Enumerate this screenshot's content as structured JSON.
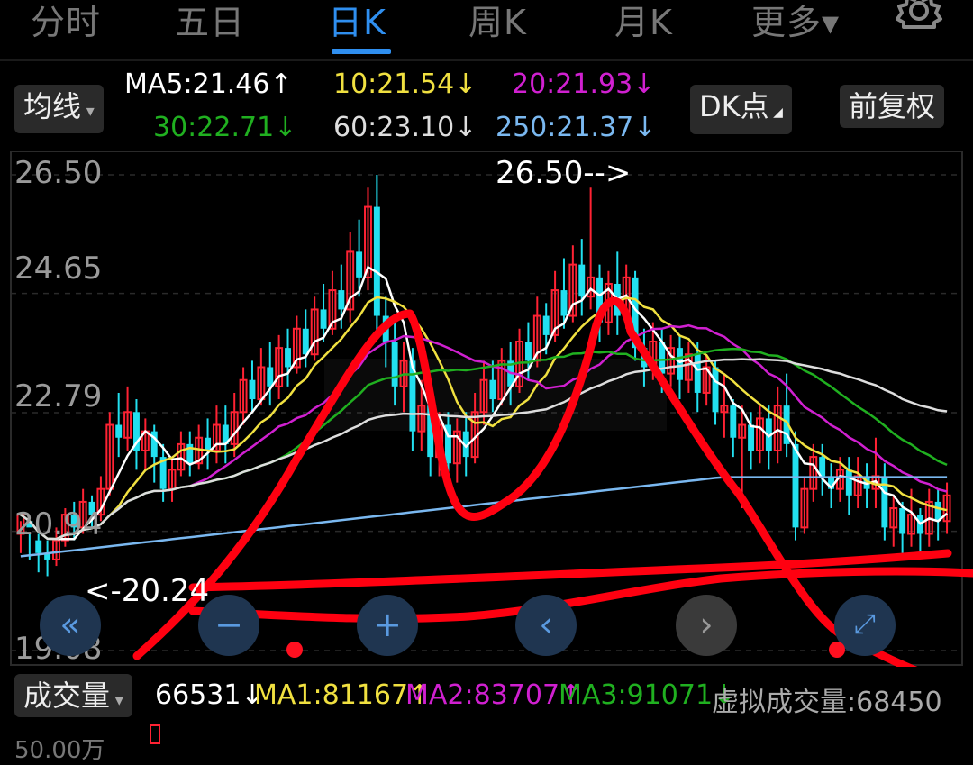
{
  "tabs": [
    {
      "label": "分时",
      "active": false
    },
    {
      "label": "五日",
      "active": false
    },
    {
      "label": "日K",
      "active": true
    },
    {
      "label": "周K",
      "active": false
    },
    {
      "label": "月K",
      "active": false
    },
    {
      "label": "更多▾",
      "active": false
    }
  ],
  "indicator_select": "均线",
  "ma_labels": {
    "ma5": "MA5:21.46↑",
    "ma10": "10:21.54↓",
    "ma20": "20:21.93↓",
    "ma30": "30:22.71↓",
    "ma60": "60:23.10↓",
    "ma250": "250:21.37↓"
  },
  "dk_button": "DK点",
  "adjust_button": "前复权",
  "icons": [
    "settings-gear-icon",
    "double-left-icon",
    "zoom-out-icon",
    "zoom-in-icon",
    "left-icon",
    "right-icon",
    "fullscreen-icon"
  ],
  "colors": {
    "up": "#ff2233",
    "down": "#22e0f0",
    "ma5": "#ffffff",
    "ma10": "#f0e040",
    "ma20": "#d020d0",
    "ma30": "#20b020",
    "ma60": "#dddddd",
    "ma250": "#7ab8f0",
    "accent": "#2f8ff0",
    "drawing": "#ff0010"
  },
  "chart_data": {
    "type": "candlestick",
    "y_ticks": [
      "26.50",
      "24.65",
      "22.79",
      "20.94",
      "19.08"
    ],
    "ylim": [
      19.08,
      26.5
    ],
    "annotations": {
      "high_label": "26.50-->",
      "low_label": "<-20.24"
    },
    "candles": [
      [
        20.9,
        21.2,
        20.6,
        21.1
      ],
      [
        21.1,
        21.0,
        20.5,
        20.9
      ],
      [
        20.8,
        20.6,
        20.3,
        20.9
      ],
      [
        20.6,
        20.5,
        20.24,
        20.8
      ],
      [
        20.5,
        20.8,
        20.4,
        21.0
      ],
      [
        20.8,
        21.2,
        20.7,
        21.3
      ],
      [
        21.2,
        21.0,
        20.8,
        21.4
      ],
      [
        21.0,
        21.4,
        20.9,
        21.6
      ],
      [
        21.4,
        21.2,
        21.0,
        21.5
      ],
      [
        21.2,
        21.6,
        21.1,
        21.8
      ],
      [
        21.6,
        22.6,
        21.5,
        22.8
      ],
      [
        22.6,
        22.4,
        22.1,
        23.1
      ],
      [
        22.4,
        22.8,
        22.2,
        23.2
      ],
      [
        22.8,
        22.2,
        21.9,
        23.0
      ],
      [
        22.2,
        22.5,
        21.9,
        22.7
      ],
      [
        22.5,
        22.1,
        21.7,
        22.6
      ],
      [
        22.1,
        21.6,
        21.4,
        22.3
      ],
      [
        21.6,
        21.9,
        21.4,
        22.1
      ],
      [
        21.9,
        22.3,
        21.8,
        22.5
      ],
      [
        22.3,
        22.0,
        21.8,
        22.5
      ],
      [
        22.0,
        22.4,
        21.9,
        22.6
      ],
      [
        22.4,
        22.2,
        21.9,
        22.7
      ],
      [
        22.2,
        22.6,
        22.0,
        22.9
      ],
      [
        22.6,
        22.3,
        22.0,
        22.9
      ],
      [
        22.3,
        22.8,
        22.1,
        23.1
      ],
      [
        22.8,
        23.3,
        22.6,
        23.5
      ],
      [
        23.3,
        23.0,
        22.8,
        23.6
      ],
      [
        23.0,
        23.5,
        22.9,
        23.8
      ],
      [
        23.5,
        23.2,
        22.9,
        23.9
      ],
      [
        23.2,
        23.8,
        23.0,
        24.0
      ],
      [
        23.8,
        23.5,
        23.2,
        24.1
      ],
      [
        23.5,
        24.1,
        23.4,
        24.3
      ],
      [
        24.1,
        23.7,
        23.5,
        24.4
      ],
      [
        23.7,
        24.4,
        23.6,
        24.6
      ],
      [
        24.4,
        24.1,
        23.9,
        24.8
      ],
      [
        24.1,
        24.7,
        24.0,
        25.0
      ],
      [
        24.7,
        24.4,
        24.1,
        25.1
      ],
      [
        24.4,
        25.3,
        24.2,
        25.6
      ],
      [
        25.3,
        24.9,
        24.6,
        25.8
      ],
      [
        24.9,
        26.0,
        24.7,
        26.3
      ],
      [
        26.0,
        24.3,
        24.0,
        26.5
      ],
      [
        24.3,
        23.9,
        23.5,
        24.6
      ],
      [
        23.9,
        23.2,
        22.9,
        24.2
      ],
      [
        23.2,
        23.6,
        22.8,
        23.9
      ],
      [
        23.6,
        22.5,
        22.2,
        23.8
      ],
      [
        22.5,
        22.9,
        22.2,
        23.3
      ],
      [
        22.9,
        22.1,
        21.8,
        23.1
      ],
      [
        22.1,
        22.6,
        21.8,
        22.8
      ],
      [
        22.6,
        22.0,
        21.7,
        22.8
      ],
      [
        22.0,
        22.5,
        21.7,
        22.7
      ],
      [
        22.5,
        22.1,
        21.8,
        22.8
      ],
      [
        22.1,
        22.8,
        22.0,
        23.1
      ],
      [
        22.8,
        23.3,
        22.6,
        23.6
      ],
      [
        23.3,
        23.0,
        22.8,
        23.6
      ],
      [
        23.0,
        23.6,
        22.9,
        23.8
      ],
      [
        23.6,
        23.2,
        22.9,
        23.9
      ],
      [
        23.2,
        23.9,
        23.1,
        24.1
      ],
      [
        23.9,
        23.6,
        23.3,
        24.2
      ],
      [
        23.6,
        24.3,
        23.5,
        24.6
      ],
      [
        24.3,
        24.0,
        23.7,
        24.5
      ],
      [
        24.0,
        24.7,
        23.9,
        25.0
      ],
      [
        24.7,
        24.3,
        24.1,
        25.2
      ],
      [
        24.3,
        25.1,
        24.2,
        25.4
      ],
      [
        25.1,
        24.6,
        24.3,
        25.5
      ],
      [
        24.6,
        24.9,
        24.4,
        26.3
      ],
      [
        24.9,
        24.2,
        23.9,
        25.1
      ],
      [
        24.2,
        24.8,
        24.0,
        25.0
      ],
      [
        24.8,
        24.3,
        24.0,
        25.3
      ],
      [
        24.3,
        24.9,
        24.1,
        25.1
      ],
      [
        24.9,
        23.8,
        23.6,
        25.0
      ],
      [
        23.8,
        23.5,
        23.2,
        24.1
      ],
      [
        23.5,
        23.9,
        23.3,
        24.2
      ],
      [
        23.9,
        23.4,
        23.1,
        24.1
      ],
      [
        23.4,
        23.8,
        23.2,
        24.0
      ],
      [
        23.8,
        23.3,
        23.0,
        24.0
      ],
      [
        23.3,
        23.7,
        23.1,
        23.9
      ],
      [
        23.7,
        23.1,
        22.8,
        23.9
      ],
      [
        23.1,
        23.5,
        22.9,
        23.7
      ],
      [
        23.5,
        22.8,
        22.6,
        23.6
      ],
      [
        22.8,
        22.9,
        22.4,
        23.4
      ],
      [
        22.9,
        22.4,
        22.1,
        23.0
      ],
      [
        22.4,
        22.6,
        21.3,
        22.9
      ],
      [
        22.6,
        22.2,
        21.9,
        22.8
      ],
      [
        22.2,
        22.7,
        22.0,
        22.9
      ],
      [
        22.7,
        22.2,
        21.9,
        22.9
      ],
      [
        22.2,
        22.9,
        22.0,
        23.2
      ],
      [
        22.9,
        22.3,
        22.1,
        23.4
      ],
      [
        22.3,
        21.0,
        20.8,
        22.5
      ],
      [
        21.0,
        21.6,
        20.9,
        21.8
      ],
      [
        21.6,
        22.1,
        21.4,
        22.3
      ],
      [
        22.1,
        21.8,
        21.5,
        22.3
      ],
      [
        21.8,
        21.6,
        21.3,
        22.0
      ],
      [
        21.6,
        21.9,
        21.4,
        22.1
      ],
      [
        21.9,
        21.5,
        21.2,
        22.1
      ],
      [
        21.5,
        21.8,
        21.3,
        22.1
      ],
      [
        21.8,
        21.6,
        21.3,
        22.0
      ],
      [
        21.6,
        21.8,
        21.3,
        22.4
      ],
      [
        21.8,
        21.0,
        20.8,
        22.0
      ],
      [
        21.0,
        21.3,
        20.7,
        21.5
      ],
      [
        21.3,
        20.9,
        20.6,
        21.4
      ],
      [
        20.9,
        21.2,
        20.7,
        21.6
      ],
      [
        21.2,
        20.9,
        20.6,
        21.3
      ],
      [
        20.9,
        21.4,
        20.7,
        21.6
      ],
      [
        21.4,
        21.1,
        20.8,
        21.6
      ],
      [
        21.1,
        21.5,
        20.9,
        21.7
      ]
    ]
  },
  "volume_bar": {
    "select": "成交量",
    "value": "66531↓",
    "ma1": "MA1:81167↑",
    "ma2": "MA2:83707↑",
    "ma3": "MA3:91071↓",
    "virtual": "虚拟成交量:68450",
    "axis_partial": "50.00万"
  }
}
